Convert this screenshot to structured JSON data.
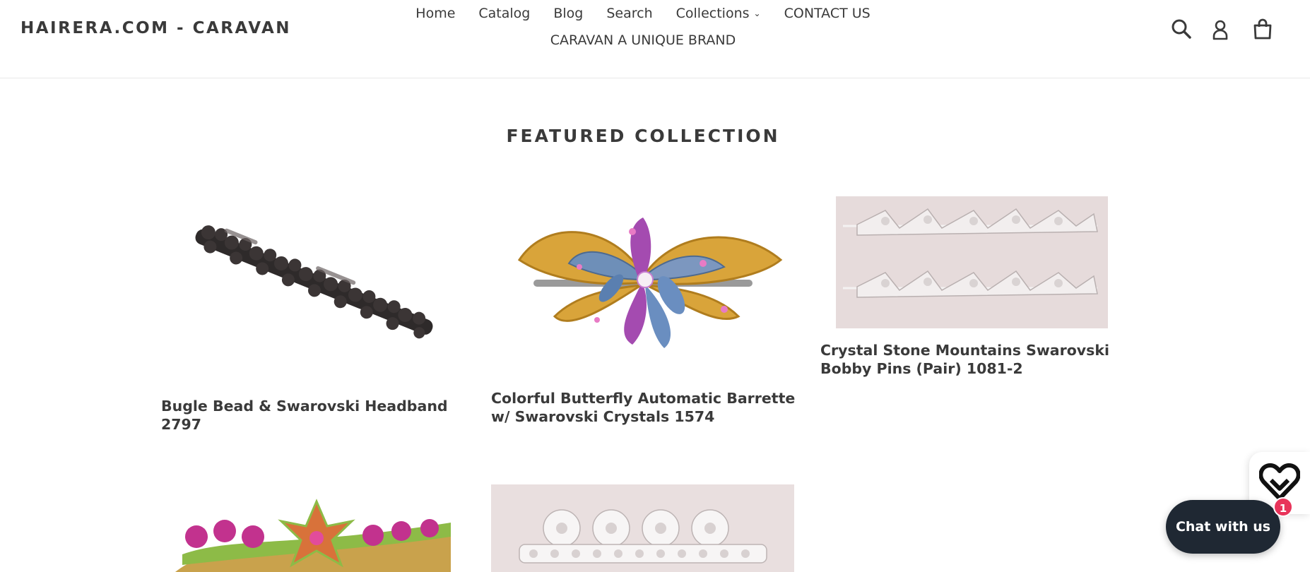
{
  "header": {
    "logo": "HAIRERA.COM - CARAVAN",
    "nav_row1": [
      "Home",
      "Catalog",
      "Blog",
      "Search",
      "Collections",
      "CONTACT US"
    ],
    "nav_row2": [
      "CARAVAN A UNIQUE BRAND"
    ],
    "icons": [
      "search-icon",
      "account-icon",
      "cart-icon"
    ]
  },
  "section": {
    "title": "FEATURED COLLECTION"
  },
  "products": [
    {
      "title": "Bugle Bead & Swarovski Headband 2797",
      "image": "black-bugle-bead-headband"
    },
    {
      "title": "Colorful Butterfly Automatic Barrette w/ Swarovski Crystals 1574",
      "image": "colorful-butterfly-barrette"
    },
    {
      "title": "Crystal Stone Mountains Swarovski Bobby Pins (Pair) 1081-2",
      "image": "crystal-bobby-pins"
    },
    {
      "title": "",
      "image": "pink-flower-barrette"
    },
    {
      "title": "",
      "image": "crystal-rhinestone-barrette"
    }
  ],
  "chat": {
    "label": "Chat with us",
    "badge_count": "1",
    "heart_icon": "heart-icon"
  },
  "colors": {
    "text": "#3a3a3a",
    "chat_bg": "#1f2833",
    "badge": "#e8345a"
  }
}
